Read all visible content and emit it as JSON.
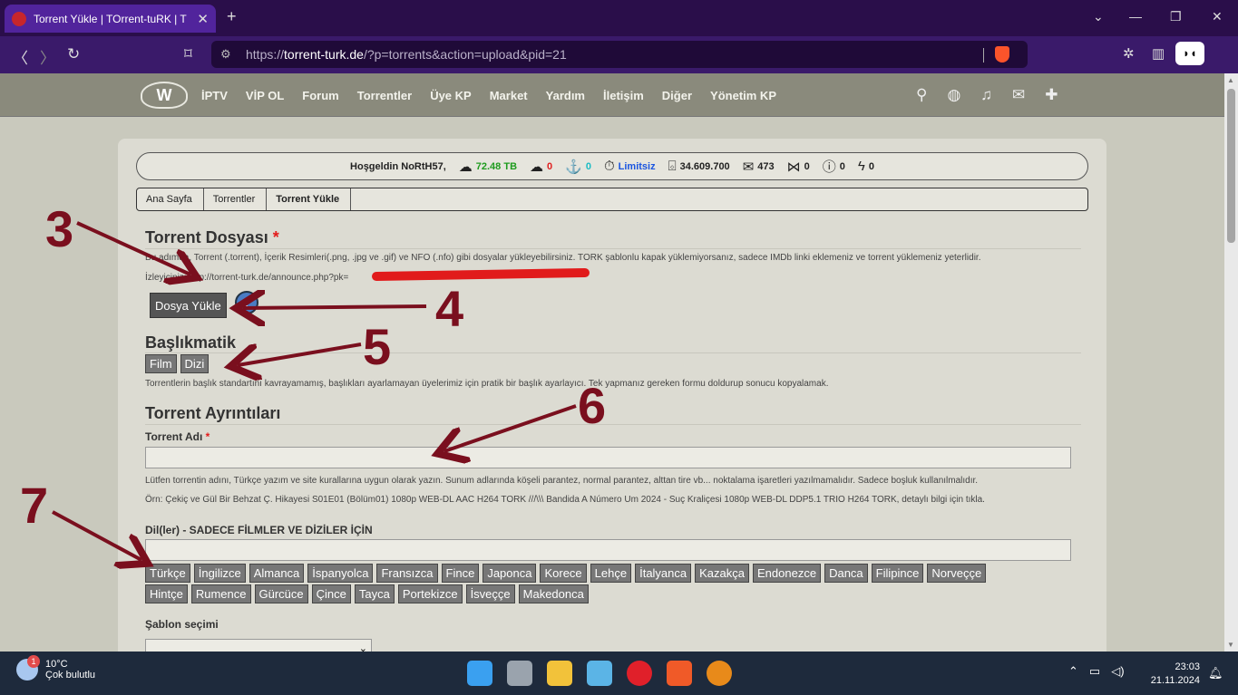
{
  "browser": {
    "tab_title": "Torrent Yükle | TOrrent-tuRK | T",
    "url_host": "torrent-turk.de",
    "url_prefix": "https://",
    "url_path": "/?p=torrents&action=upload&pid=21"
  },
  "nav": {
    "items": [
      "İPTV",
      "VİP OL",
      "Forum",
      "Torrentler",
      "Üye KP",
      "Market",
      "Yardım",
      "İletişim",
      "Diğer",
      "Yönetim KP"
    ]
  },
  "stats": {
    "greeting": "Hoşgeldin NoRtH57,",
    "upload": "72.48 TB",
    "download": "0",
    "seeding": "0",
    "limit": "Limitsiz",
    "points": "34.609.700",
    "messages": "473",
    "shares": "0",
    "warnings": "0",
    "flash": "0"
  },
  "breadcrumb": [
    "Ana Sayfa",
    "Torrentler",
    "Torrent Yükle"
  ],
  "torrent_file": {
    "title": "Torrent Dosyası",
    "note": "Bu adımda, Torrent (.torrent), İçerik Resimleri(.png, .jpg ve .gif) ve NFO (.nfo) gibi dosyalar yükleyebilirsiniz. TORK şablonlu kapak yüklemiyorsanız, sadece IMDb linki eklemeniz ve torrent yüklemeniz yeterlidir.",
    "announce": "İzleyiciniz: http://torrent-turk.de/announce.php?pk=",
    "upload_button": "Dosya Yükle",
    "help": "?"
  },
  "baslikmatik": {
    "title": "Başlıkmatik",
    "buttons": [
      "Film",
      "Dizi"
    ],
    "note": "Torrentlerin başlık standartını kavrayamamış, başlıkları ayarlamayan üyelerimiz için pratik bir başlık ayarlayıcı. Tek yapmanız gereken formu doldurup sonucu kopyalamak."
  },
  "details": {
    "title": "Torrent Ayrıntıları",
    "name_label": "Torrent Adı",
    "name_value": "",
    "hint1": "Lütfen torrentin adını, Türkçe yazım ve site kurallarına uygun olarak yazın. Sunum adlarında köşeli parantez, normal parantez, alttan tire vb... noktalama işaretleri yazılmamalıdır. Sadece boşluk kullanılmalıdır.",
    "hint2": "Örn: Çekiç ve Gül Bir Behzat Ç. Hikayesi S01E01 (Bölüm01) 1080p WEB-DL AAC H264 TORK ///\\\\\\ Bandida A Número Um 2024 - Suç Kraliçesi 1080p WEB-DL DDP5.1 TRIO H264 TORK, detaylı bilgi için tıkla.",
    "lang_label": "Dil(ler) - SADECE FİLMLER VE DİZİLER İÇİN",
    "lang_value": "",
    "languages_row1": [
      "Türkçe",
      "İngilizce",
      "Almanca",
      "İspanyolca",
      "Fransızca",
      "Fince",
      "Japonca",
      "Korece",
      "Lehçe",
      "İtalyanca",
      "Kazakça",
      "Endonezce",
      "Danca",
      "Filipince",
      "Norveççe"
    ],
    "languages_row2": [
      "Hintçe",
      "Rumence",
      "Gürcüce",
      "Çince",
      "Tayca",
      "Portekizce",
      "İsveççe",
      "Makedonca"
    ],
    "template_label": "Şablon seçimi",
    "template_value": "⌄"
  },
  "annotations": [
    "3",
    "4",
    "5",
    "6",
    "7"
  ],
  "taskbar": {
    "temp": "10°C",
    "weather": "Çok bulutlu",
    "notif": "1",
    "time": "23:03",
    "date": "21.11.2024"
  },
  "colors": {
    "accent_purple": "#51249c",
    "annotation": "#7a0f1e",
    "required": "#e31b1b"
  }
}
